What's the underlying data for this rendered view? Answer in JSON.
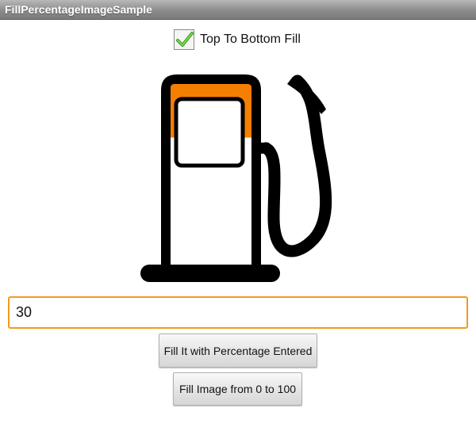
{
  "app": {
    "title": "FillPercentageImageSample"
  },
  "options": {
    "top_to_bottom_label": "Top To Bottom Fill",
    "top_to_bottom_checked": true
  },
  "image": {
    "icon": "fuel-pump-icon",
    "fill_percent": 30,
    "fill_color": "#f57f00",
    "outline_color": "#000000"
  },
  "input": {
    "value": "30",
    "accent_color": "#f39a1e"
  },
  "buttons": {
    "fill_label": "Fill It with Percentage Entered",
    "animate_label": "Fill Image from 0 to 100"
  }
}
